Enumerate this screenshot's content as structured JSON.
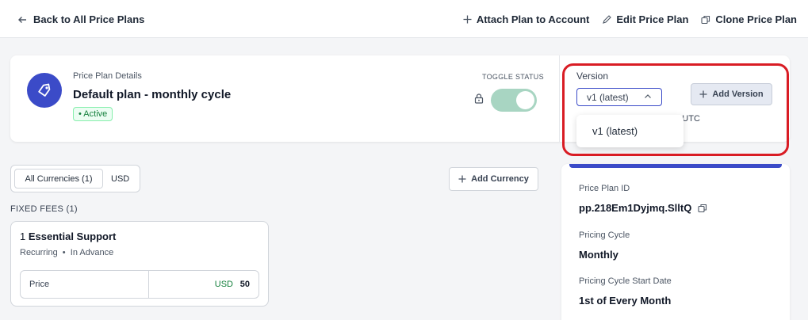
{
  "topbar": {
    "back_label": "Back to All Price Plans",
    "attach_label": "Attach Plan to Account",
    "edit_label": "Edit Price Plan",
    "clone_label": "Clone Price Plan"
  },
  "details": {
    "section_label": "Price Plan Details",
    "plan_name": "Default plan - monthly cycle",
    "status": "• Active",
    "toggle_label": "TOGGLE STATUS",
    "toggle_on": true
  },
  "version": {
    "label": "Version",
    "selected": "v1 (latest)",
    "add_label": "Add Version",
    "created_suffix": "22 UTC",
    "dropdown_options": [
      "v1 (latest)"
    ]
  },
  "currencies": {
    "tabs": [
      "All Currencies (1)",
      "USD"
    ],
    "add_label": "Add Currency"
  },
  "fixed_fees": {
    "header": "FIXED FEES  (1)",
    "items": [
      {
        "index": "1",
        "name": "Essential Support",
        "billing": "Recurring",
        "timing": "In Advance",
        "price_label": "Price",
        "currency": "USD",
        "amount": "50"
      }
    ]
  },
  "info": {
    "id_label": "Price Plan ID",
    "id_value": "pp.218Em1Dyjmq.SlltQ",
    "cycle_label": "Pricing Cycle",
    "cycle_value": "Monthly",
    "start_label": "Pricing Cycle Start Date",
    "start_value": "1st of Every Month"
  },
  "colors": {
    "accent": "#3b4bc8",
    "active_green": "#15803d",
    "toggle_on": "#a8d5c2",
    "highlight": "#d91c24"
  }
}
